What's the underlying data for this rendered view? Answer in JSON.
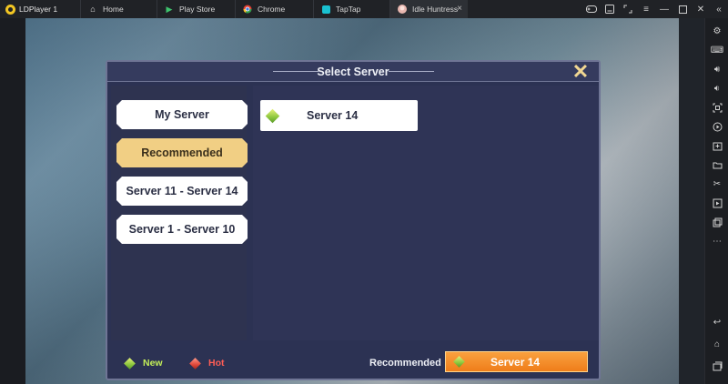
{
  "app": {
    "name": "LDPlayer 1",
    "tabs": [
      {
        "label": "Home",
        "icon": "home-icon"
      },
      {
        "label": "Play Store",
        "icon": "play-store-icon"
      },
      {
        "label": "Chrome",
        "icon": "chrome-icon"
      },
      {
        "label": "TapTap",
        "icon": "taptap-icon"
      },
      {
        "label": "Idle Huntress",
        "icon": "game-avatar-icon",
        "active": true
      }
    ]
  },
  "dialog": {
    "title": "Select Server",
    "categories": [
      {
        "label": "My Server"
      },
      {
        "label": "Recommended",
        "selected": true
      },
      {
        "label": "Server 11 - Server 14"
      },
      {
        "label": "Server 1 - Server 10"
      }
    ],
    "servers": [
      {
        "name": "Server 14",
        "status": "new"
      }
    ],
    "legend": {
      "new": "New",
      "hot": "Hot"
    },
    "recommended_label": "Recommended",
    "recommended_server": "Server 14"
  },
  "colors": {
    "dialog_bg": "#2c3253",
    "selected_tab": "#f1cf84",
    "new": "#c3ee58",
    "hot": "#ff5d55",
    "recommend_button": "#ef7d1a"
  }
}
